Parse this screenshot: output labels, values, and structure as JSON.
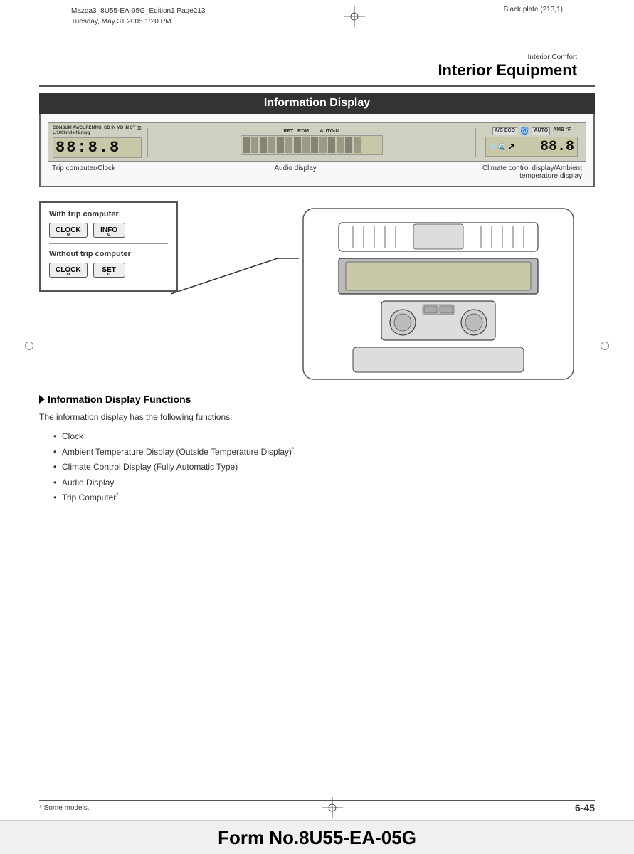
{
  "header": {
    "doc_info_line1": "Mazda3_8U55-EA-05G_Edition1  Page213",
    "doc_info_line2": "Tuesday, May 31 2005 1:20 PM",
    "plate_info": "Black plate (213,1)",
    "section_small": "Interior Comfort",
    "section_large": "Interior Equipment"
  },
  "info_display": {
    "title": "Information Display",
    "lcd": {
      "trip_labels": "CONSUM AV/CUREMNG  CD IN MD IN ST ⬜⬜",
      "trip_labels2": "L/100kmile/hLmpg",
      "trip_digits": "88:8.8",
      "audio_labels": "RPT  RDM       AUTO-M",
      "climate_labels": "A/C ECO    AUTO AMB °F",
      "climate_digits": "88.8"
    },
    "labels": {
      "left": "Trip computer/Clock",
      "center": "Audio display",
      "right": "Climate control display/Ambient temperature display"
    },
    "buttons": {
      "with_trip_title": "With trip computer",
      "btn_clock": "CLOCK",
      "btn_info": "INFO",
      "without_trip_title": "Without trip computer",
      "btn_clock2": "CLOCK",
      "btn_set": "SET"
    }
  },
  "functions_section": {
    "heading": "Information Display Functions",
    "intro": "The information display has the following functions:",
    "items": [
      {
        "text": "Clock",
        "asterisk": false
      },
      {
        "text": "Ambient Temperature Display (Outside Temperature Display)",
        "asterisk": true
      },
      {
        "text": "Climate Control Display (Fully Automatic Type)",
        "asterisk": false
      },
      {
        "text": "Audio Display",
        "asterisk": false
      },
      {
        "text": "Trip Computer",
        "asterisk": true
      }
    ]
  },
  "footer": {
    "footnote": "* Some models.",
    "page": "6-45",
    "form_number": "Form No.8U55-EA-05G"
  }
}
